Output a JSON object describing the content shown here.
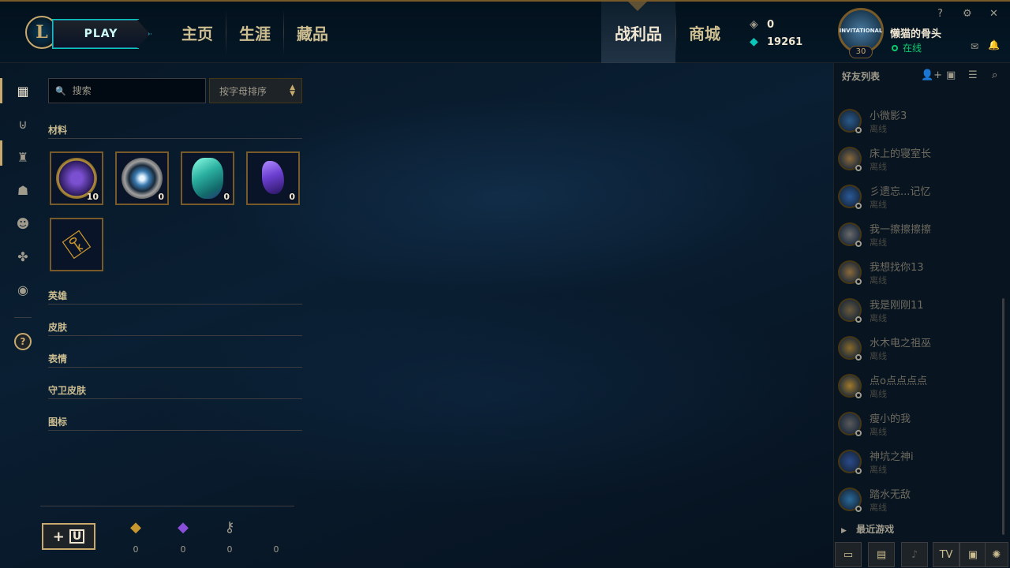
{
  "header": {
    "play_label": "PLAY",
    "nav": [
      "主页",
      "生涯",
      "藏品"
    ],
    "nav_right": [
      "战利品",
      "商城"
    ],
    "rp": "0",
    "be": "19261"
  },
  "profile": {
    "badge_text": "INVITATIONAL",
    "level": "30",
    "username": "懒猫的骨头",
    "status": "在线"
  },
  "window_controls": [
    "?",
    "⚙",
    "✕"
  ],
  "search": {
    "placeholder": "搜索"
  },
  "sort": {
    "label": "按字母排序"
  },
  "categories": {
    "materials": "材料",
    "champions": "英雄",
    "skins": "皮肤",
    "emotes": "表情",
    "ward_skins": "守卫皮肤",
    "icons": "图标"
  },
  "loot": [
    {
      "name": "hextech-chest",
      "count": "10",
      "color": "#6a3fb5"
    },
    {
      "name": "mastery-token",
      "count": "0",
      "color": "#8fa8b8"
    },
    {
      "name": "orange-essence-gem",
      "count": "0",
      "color": "#2bb0a0"
    },
    {
      "name": "mythic-shard",
      "count": "0",
      "color": "#6b3fd0"
    },
    {
      "name": "hextech-key",
      "count": "",
      "color": "#c8962e"
    }
  ],
  "craft_button": {
    "label": "+"
  },
  "resources": [
    {
      "icon": "key-fragment-icon",
      "glyph": "◆",
      "color": "#c8962e",
      "value": "0"
    },
    {
      "icon": "gem-icon",
      "glyph": "◆",
      "color": "#8a4fd8",
      "value": "0"
    },
    {
      "icon": "key-icon",
      "glyph": "⚷",
      "color": "#a09b8c",
      "value": "0"
    },
    {
      "icon": "blank",
      "glyph": "",
      "color": "#a09b8c",
      "value": "0"
    }
  ],
  "social": {
    "title": "好友列表",
    "recent_games": "最近游戏",
    "friends": [
      {
        "name": "小微影3",
        "status": "离线"
      },
      {
        "name": "床上的寝室长",
        "status": "离线"
      },
      {
        "name": "彡遗忘...记忆",
        "status": "离线"
      },
      {
        "name": "我一擦擦擦擦",
        "status": "离线"
      },
      {
        "name": "我想找你13",
        "status": "离线"
      },
      {
        "name": "我是刚刚11",
        "status": "离线"
      },
      {
        "name": "水木电之祖巫",
        "status": "离线"
      },
      {
        "name": "点o点点点点",
        "status": "离线"
      },
      {
        "name": "瘦小的我",
        "status": "离线"
      },
      {
        "name": "神坑之神i",
        "status": "离线"
      },
      {
        "name": "踏水无敌",
        "status": "离线"
      }
    ],
    "bottom_buttons": [
      "chat-icon",
      "notes-icon",
      "mic-icon",
      "tv-icon",
      "window-icon",
      "bug-icon"
    ]
  }
}
